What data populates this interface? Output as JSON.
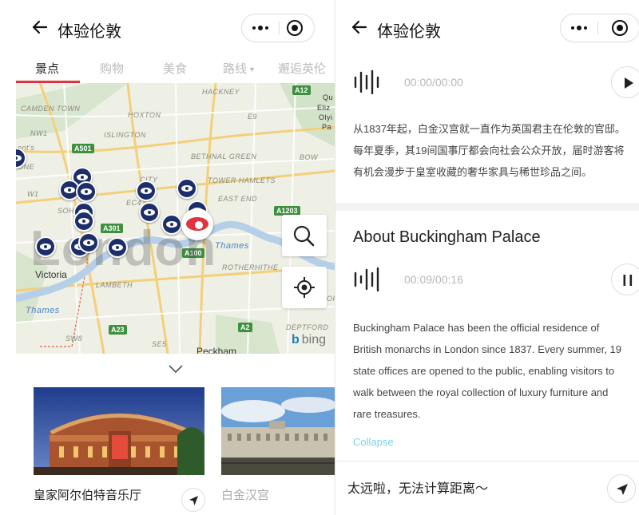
{
  "left": {
    "title": "体验伦敦",
    "tabs": [
      {
        "label": "景点",
        "active": true
      },
      {
        "label": "购物",
        "active": false
      },
      {
        "label": "美食",
        "active": false
      },
      {
        "label": "路线",
        "active": false,
        "has_caret": true
      },
      {
        "label": "邂逅英伦",
        "active": false
      }
    ],
    "map": {
      "watermark": "London",
      "place_labels": [
        "HACKNEY",
        "CAMDEN TOWN",
        "HOXTON",
        "E9",
        "NW1",
        "ISLINGTON",
        "BETHNAL GREEN",
        "BOW",
        "W1",
        "CITY",
        "TOWER HAMLETS",
        "EAST END",
        "SOHO",
        "EC4",
        "Victoria",
        "LAMBETH",
        "ROTHERHITHE",
        "SW8",
        "SE5",
        "Peckham",
        "DEPTFORD",
        "OF"
      ],
      "water_labels": [
        "Thames",
        "Thames"
      ],
      "road_badges": [
        "A12",
        "A501",
        "A1203",
        "A301",
        "A100",
        "A23",
        "A2"
      ],
      "cut_labels": [
        "Qu",
        "Eliz",
        "Olyi",
        "Pa",
        "ent's",
        "ONE",
        "W",
        "loo"
      ],
      "attribution": "bing",
      "attribution_brand": "b",
      "search_icon": "search-icon",
      "locate_icon": "locate-icon"
    },
    "cards": [
      {
        "name": "皇家阿尔伯特音乐厅",
        "photo": "royal-albert-hall-photo"
      },
      {
        "name": "白金汉宫",
        "photo": "buckingham-palace-photo"
      }
    ]
  },
  "right": {
    "title": "体验伦敦",
    "audio1": {
      "time": "00:00/00:00",
      "state": "play"
    },
    "text_zh": "从1837年起，白金汉宫就一直作为英国君主在伦敦的官邸。每年夏季，其19间国事厅都会向社会公众开放，届时游客将有机会漫步于皇室收藏的奢华家具与稀世珍品之间。",
    "section_title": "About Buckingham Palace",
    "audio2": {
      "time": "00:09/00:16",
      "state": "pause"
    },
    "text_en": "Buckingham Palace has been the official residence of British monarchs in London since 1837. Every summer, 19 state offices are opened to the public, enabling visitors to walk between the royal collection of luxury furniture and rare treasures.",
    "collapse_label": "Collapse",
    "bottom_text": "太远啦，无法计算距离～"
  },
  "colors": {
    "accent_red": "#e0343e",
    "pin_navy": "#1d2f6b",
    "road_green": "#3e8f3e",
    "link_cyan": "#7ad0e6",
    "water_blue": "#4a82c4"
  }
}
